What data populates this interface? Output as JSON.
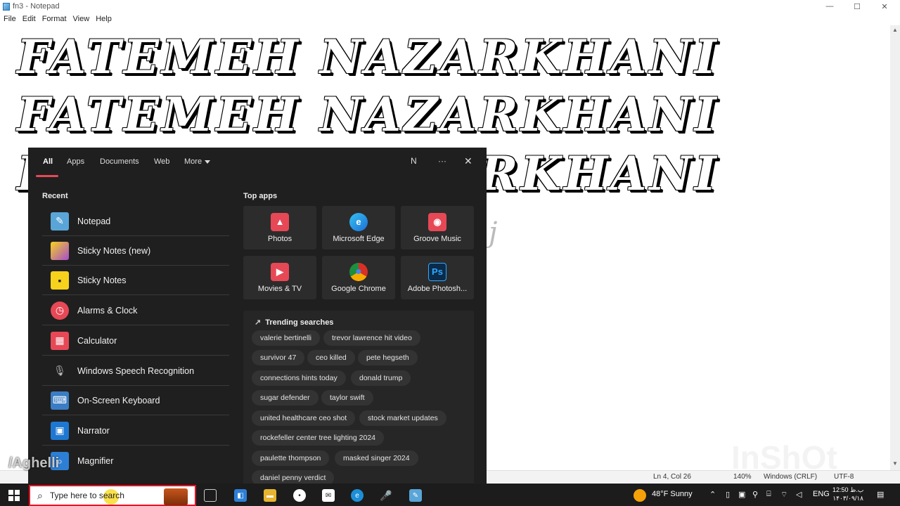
{
  "window": {
    "title": "fn3 - Notepad",
    "minimize": "—",
    "maximize": "☐",
    "close": "✕"
  },
  "menu": [
    "File",
    "Edit",
    "Format",
    "View",
    "Help"
  ],
  "editor": {
    "lines": [
      "FATEMEH NAZARKHANI",
      "FATEMEH NAZARKHANI",
      "FATEMEH NAZARKHANI"
    ],
    "partial": "j"
  },
  "status": {
    "position": "Ln 4, Col 26",
    "zoom": "140%",
    "eol": "Windows (CRLF)",
    "encoding": "UTF-8"
  },
  "flyout": {
    "tabs": [
      "All",
      "Apps",
      "Documents",
      "Web",
      "More"
    ],
    "avatar": "N",
    "more_dots": "···",
    "close": "✕",
    "recent_title": "Recent",
    "recent": [
      {
        "label": "Notepad",
        "icon": "notepad-icon",
        "color": "#5aa5d8"
      },
      {
        "label": "Sticky Notes (new)",
        "icon": "sticky-notes-icon",
        "color": "#f2b01e"
      },
      {
        "label": "Sticky Notes",
        "icon": "sticky-notes-icon",
        "color": "#f7d21c"
      },
      {
        "label": "Alarms & Clock",
        "icon": "alarm-clock-icon",
        "color": "#e74856"
      },
      {
        "label": "Calculator",
        "icon": "calculator-icon",
        "color": "#e74856"
      },
      {
        "label": "Windows Speech Recognition",
        "icon": "microphone-icon",
        "color": "#777777"
      },
      {
        "label": "On-Screen Keyboard",
        "icon": "keyboard-icon",
        "color": "#3b7dc4"
      },
      {
        "label": "Narrator",
        "icon": "narrator-icon",
        "color": "#1e78d2"
      },
      {
        "label": "Magnifier",
        "icon": "magnifier-icon",
        "color": "#2d7fd6"
      }
    ],
    "top_apps_title": "Top apps",
    "top_apps": [
      {
        "label": "Photos",
        "icon": "photos-icon",
        "color": "#e74856",
        "glyph": "▲"
      },
      {
        "label": "Microsoft Edge",
        "icon": "edge-icon",
        "color": "#1d8fd8",
        "glyph": "e"
      },
      {
        "label": "Groove Music",
        "icon": "groove-music-icon",
        "color": "#e74856",
        "glyph": "◉"
      },
      {
        "label": "Movies & TV",
        "icon": "movies-tv-icon",
        "color": "#e74856",
        "glyph": "▶"
      },
      {
        "label": "Google Chrome",
        "icon": "chrome-icon",
        "color": "#d93025",
        "glyph": "●"
      },
      {
        "label": "Adobe Photosh...",
        "icon": "photoshop-icon",
        "color": "#0a2b4a",
        "glyph": "Ps"
      }
    ],
    "trending_title": "Trending searches",
    "trending_arrow": "↗",
    "trending": [
      "valerie bertinelli",
      "trevor lawrence hit video",
      "survivor 47",
      "ceo killed",
      "pete hegseth",
      "connections hints today",
      "donald trump",
      "sugar defender",
      "taylor swift",
      "united healthcare ceo shot",
      "stock market updates",
      "rockefeller center tree lighting 2024",
      "paulette thompson",
      "masked singer 2024",
      "daniel penny verdict"
    ]
  },
  "taskbar": {
    "search_placeholder": "Type here to search",
    "weather": "48°F  Sunny",
    "language": "ENG",
    "time": "12:50 ب.ظ",
    "date": "۱۴۰۳/۰۹/۱۸"
  },
  "watermark": {
    "left": "/Aghelli",
    "right": "InShOt"
  }
}
